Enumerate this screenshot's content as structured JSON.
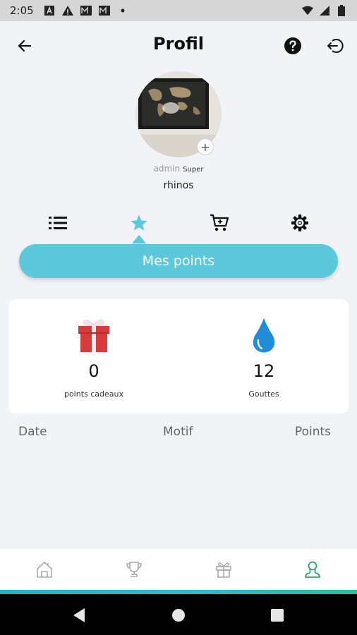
{
  "status_bar": {
    "time": "2:05",
    "left_icons": [
      "font-icon",
      "alert-icon",
      "mail-icon",
      "mail-icon",
      "dot-icon"
    ],
    "right_icons": [
      "wifi-icon",
      "signal-icon",
      "battery-icon"
    ]
  },
  "header": {
    "title": "Profil",
    "back_icon": "arrow-left-icon",
    "help_icon": "help-circle-icon",
    "logout_icon": "logout-icon"
  },
  "profile": {
    "add_photo": "+",
    "role": "admin",
    "role_badge": "Super",
    "username": "rhinos"
  },
  "tabs": [
    {
      "icon": "list-icon",
      "active": false
    },
    {
      "icon": "star-icon",
      "active": true
    },
    {
      "icon": "cart-icon",
      "active": false
    },
    {
      "icon": "gear-icon",
      "active": false
    }
  ],
  "points_banner": {
    "label": "Mes points"
  },
  "summary": {
    "gifts": {
      "icon": "gift-icon",
      "value": "0",
      "label": "points cadeaux"
    },
    "drops": {
      "icon": "drop-icon",
      "value": "12",
      "label": "Gouttes"
    }
  },
  "table": {
    "columns": [
      "Date",
      "Motif",
      "Points"
    ]
  },
  "bottom_nav": [
    {
      "icon": "home-icon",
      "active": false
    },
    {
      "icon": "trophy-icon",
      "active": false
    },
    {
      "icon": "gift-icon",
      "active": false
    },
    {
      "icon": "profile-icon",
      "active": true
    }
  ],
  "colors": {
    "accent": "#5bc8dc",
    "gift": "#d93a3a",
    "drop": "#1e8ed8",
    "active_nav": "#2aa66b"
  }
}
